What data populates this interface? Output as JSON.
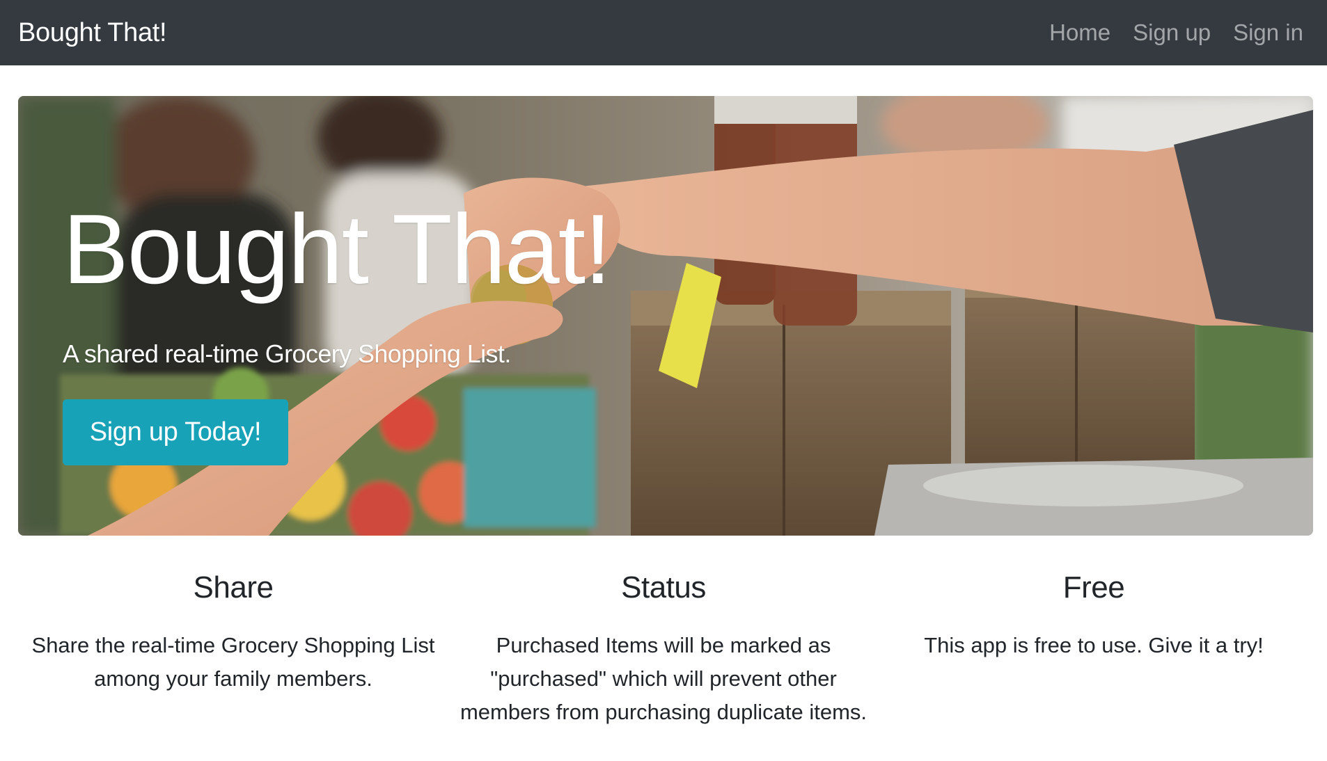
{
  "navbar": {
    "brand": "Bought That!",
    "links": [
      "Home",
      "Sign up",
      "Sign in"
    ]
  },
  "hero": {
    "title": "Bought That!",
    "subtitle": "A shared real-time Grocery Shopping List.",
    "cta": "Sign up Today!",
    "cta_color": "#17a2b8"
  },
  "features": [
    {
      "title": "Share",
      "text": "Share the real-time Grocery Shopping List among your family members."
    },
    {
      "title": "Status",
      "text": "Purchased Items will be marked as \"purchased\" which will prevent other members from purchasing duplicate items."
    },
    {
      "title": "Free",
      "text": "This app is free to use. Give it a try!"
    }
  ],
  "colors": {
    "navbar_bg": "#343a40",
    "accent": "#17a2b8"
  }
}
